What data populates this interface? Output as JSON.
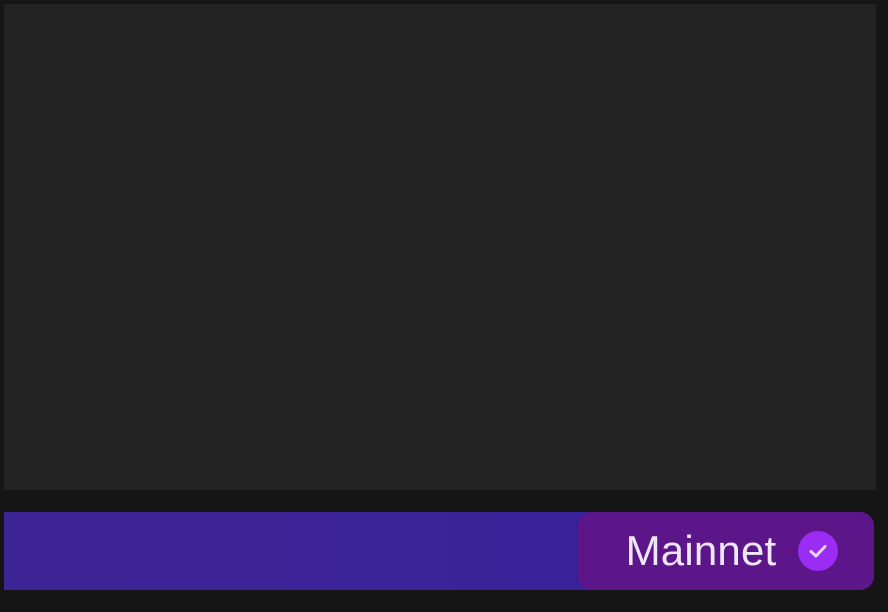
{
  "network": {
    "label": "Mainnet",
    "status_icon": "check-circle-icon",
    "accent_color": "#9b2cf3",
    "chip_color": "#5c1689",
    "bar_color": "#3b2498"
  }
}
